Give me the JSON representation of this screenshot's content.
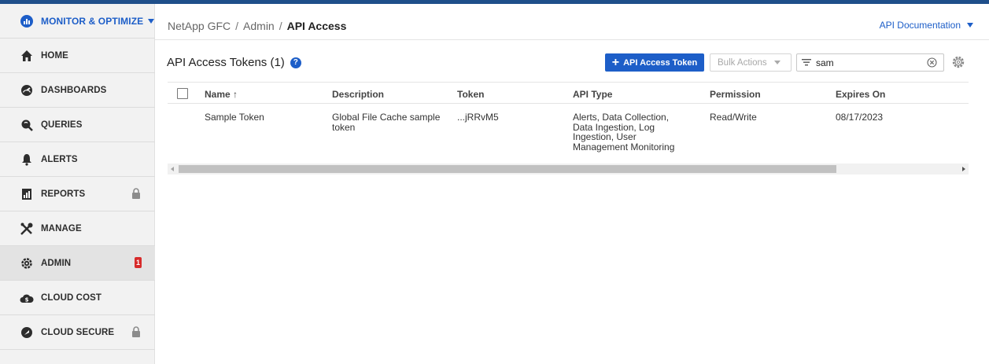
{
  "sidebar": {
    "items": [
      {
        "label": "MONITOR & OPTIMIZE",
        "icon": "monitor-optimize-icon"
      },
      {
        "label": "HOME",
        "icon": "home-icon"
      },
      {
        "label": "DASHBOARDS",
        "icon": "dashboards-icon"
      },
      {
        "label": "QUERIES",
        "icon": "queries-icon"
      },
      {
        "label": "ALERTS",
        "icon": "bell-icon"
      },
      {
        "label": "REPORTS",
        "icon": "reports-icon"
      },
      {
        "label": "MANAGE",
        "icon": "tools-icon"
      },
      {
        "label": "ADMIN",
        "icon": "admin-gear-icon",
        "badge": "1"
      },
      {
        "label": "CLOUD COST",
        "icon": "cloud-cost-icon"
      },
      {
        "label": "CLOUD SECURE",
        "icon": "shield-icon"
      }
    ]
  },
  "header": {
    "breadcrumb": [
      "NetApp GFC",
      "Admin",
      "API Access"
    ],
    "breadcrumb_sep": "/",
    "api_doc_label": "API Documentation"
  },
  "main": {
    "title": "API Access Tokens (1)",
    "add_button_label": "API Access Token",
    "bulk_actions_label": "Bulk Actions",
    "filter_value": "sam",
    "table": {
      "columns": [
        "Name ↑",
        "Description",
        "Token",
        "API Type",
        "Permission",
        "Expires On"
      ],
      "rows": [
        {
          "name": "Sample Token",
          "description": [
            "Global File Cache sample",
            "token"
          ],
          "token": "...jRRvM5",
          "api_type": [
            "Alerts, Data Collection,",
            "Data Ingestion, Log",
            "Ingestion, User",
            "Management Monitoring"
          ],
          "permission": "Read/Write",
          "expires_on": "08/17/2023"
        }
      ]
    }
  },
  "colors": {
    "accent": "#1d5ec8",
    "badge": "#d72b2b",
    "sidebar_bg": "#f2f2f2"
  }
}
